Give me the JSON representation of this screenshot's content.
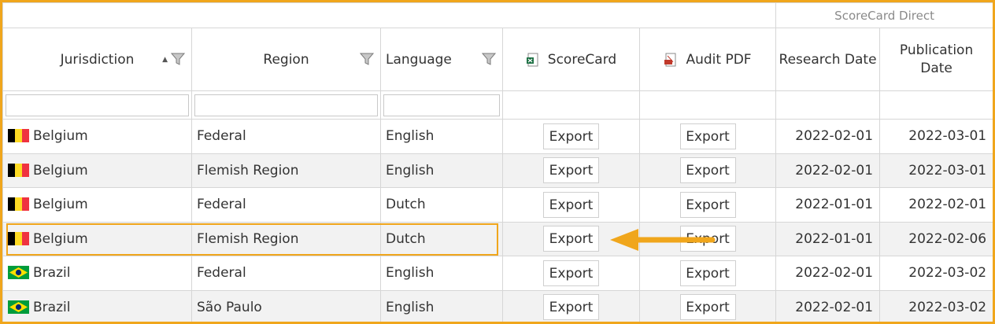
{
  "group_header": "ScoreCard Direct",
  "columns": {
    "jurisdiction": "Jurisdiction",
    "region": "Region",
    "language": "Language",
    "scorecard": "ScoreCard",
    "audit_pdf": "Audit PDF",
    "research_date": "Research Date",
    "publication_date_line1": "Publication",
    "publication_date_line2": "Date"
  },
  "icons": {
    "sort": "sort-ascending-icon",
    "filter": "filter-funnel-icon",
    "scorecard": "excel-file-icon",
    "audit": "pdf-file-icon"
  },
  "colors": {
    "highlight": "#f0a61c",
    "row_alt": "#f2f2f2",
    "border": "#d6d6d6"
  },
  "rows": [
    {
      "flag": "belgium",
      "jurisdiction": "Belgium",
      "region": "Federal",
      "language": "English",
      "scorecard": "Export",
      "audit": "Export",
      "research_date": "2022-02-01",
      "publication_date": "2022-03-01"
    },
    {
      "flag": "belgium",
      "jurisdiction": "Belgium",
      "region": "Flemish Region",
      "language": "English",
      "scorecard": "Export",
      "audit": "Export",
      "research_date": "2022-02-01",
      "publication_date": "2022-03-01"
    },
    {
      "flag": "belgium",
      "jurisdiction": "Belgium",
      "region": "Federal",
      "language": "Dutch",
      "scorecard": "Export",
      "audit": "Export",
      "research_date": "2022-01-01",
      "publication_date": "2022-02-01"
    },
    {
      "flag": "belgium",
      "jurisdiction": "Belgium",
      "region": "Flemish Region",
      "language": "Dutch",
      "scorecard": "Export",
      "audit": "Export",
      "research_date": "2022-01-01",
      "publication_date": "2022-02-06"
    },
    {
      "flag": "brazil",
      "jurisdiction": "Brazil",
      "region": "Federal",
      "language": "English",
      "scorecard": "Export",
      "audit": "Export",
      "research_date": "2022-02-01",
      "publication_date": "2022-03-02"
    },
    {
      "flag": "brazil",
      "jurisdiction": "Brazil",
      "region": "São Paulo",
      "language": "English",
      "scorecard": "Export",
      "audit": "Export",
      "research_date": "2022-02-01",
      "publication_date": "2022-03-02"
    }
  ]
}
